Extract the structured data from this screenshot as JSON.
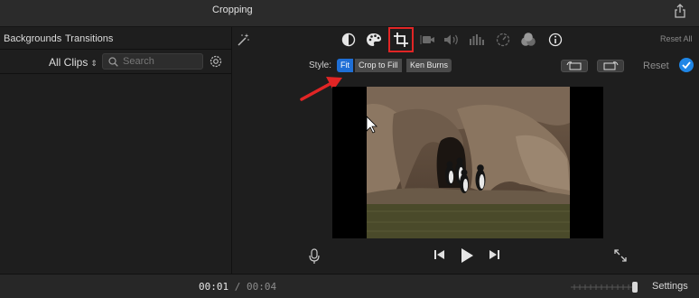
{
  "window": {
    "title": "Cropping"
  },
  "browser": {
    "tabs": [
      {
        "label": "Backgrounds"
      },
      {
        "label": "Transitions"
      }
    ],
    "filter": {
      "label": "All Clips"
    },
    "search": {
      "placeholder": "Search",
      "value": ""
    }
  },
  "toolbar": {
    "tools": [
      {
        "name": "magic-wand-icon"
      },
      {
        "name": "color-balance-icon"
      },
      {
        "name": "color-correction-icon"
      },
      {
        "name": "crop-icon",
        "selected": true
      },
      {
        "name": "stabilization-icon"
      },
      {
        "name": "volume-icon"
      },
      {
        "name": "noise-reduction-equalizer-icon"
      },
      {
        "name": "speed-icon"
      },
      {
        "name": "video-overlay-icon"
      },
      {
        "name": "clip-info-icon"
      }
    ],
    "reset_all_label": "Reset All",
    "selected_color": "#e12525"
  },
  "crop": {
    "style_label": "Style:",
    "styles": [
      {
        "label": "Fit",
        "active": true
      },
      {
        "label": "Crop to Fill",
        "active": false
      },
      {
        "label": "Ken Burns",
        "active": false
      }
    ],
    "reset_label": "Reset",
    "accent": "#1f6fd6"
  },
  "playback": {
    "current": "00:01",
    "separator": "/",
    "duration": "00:04"
  },
  "footer": {
    "settings_label": "Settings"
  }
}
